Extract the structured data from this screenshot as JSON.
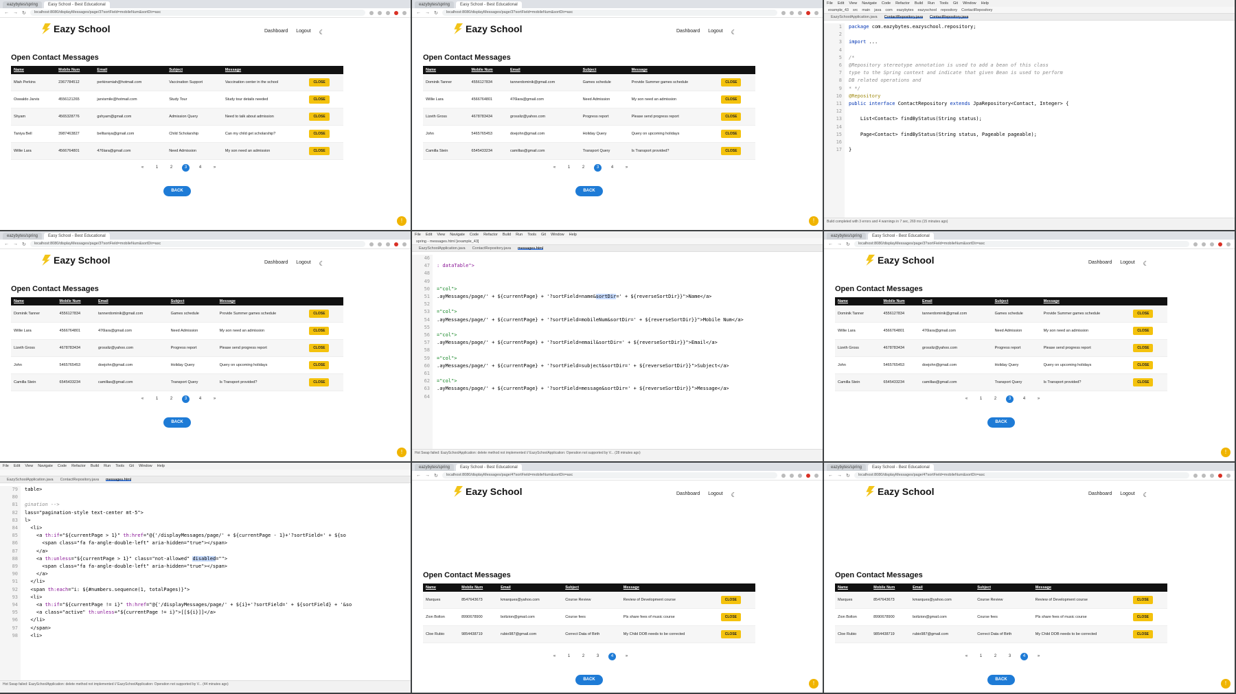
{
  "browser": {
    "tab1": "eazybytes/spring",
    "tab2": "Easy School - Best Educational",
    "url_page3": "localhost:8080/displayMessages/page/3?sortField=mobileNum&sortDir=asc",
    "url_page4": "localhost:8080/displayMessages/page/4?sortField=mobileNum&sortDir=asc"
  },
  "site": {
    "brand": "Eazy School",
    "nav_dashboard": "Dashboard",
    "nav_logout": "Logout",
    "heading": "Open Contact Messages",
    "back": "BACK",
    "close": "CLOSE",
    "columns": [
      "Name",
      "Mobile Num",
      "Email",
      "Subject",
      "Message"
    ],
    "pages": [
      "«",
      "1",
      "2",
      "3",
      "4",
      "»"
    ]
  },
  "sets": {
    "a": [
      [
        "Miah Perkins",
        "2367784512",
        "perkinsmiah@hotmail.com",
        "Vaccination Support",
        "Vaccination center in the school"
      ],
      [
        "Oswaldo Jarvis",
        "4556121265",
        "jarvismile@hotmail.com",
        "Study Tour",
        "Study tour details needed"
      ],
      [
        "Shyam",
        "4565328776",
        "gshyam@gmail.com",
        "Admission Query",
        "Need to talk about admission"
      ],
      [
        "Taniya Bell",
        "3987463827",
        "belltaniya@gmail.com",
        "Child Scholarship",
        "Can my child get scholarship?"
      ],
      [
        "Willie Lara",
        "4566764801",
        "476lara@gmail.com",
        "Need Admission",
        "My son need an admission"
      ]
    ],
    "b": [
      [
        "Dominik Tanner",
        "4556127834",
        "tannerdominik@gmail.com",
        "Games schedule",
        "Provide Summer games schedule"
      ],
      [
        "Willie Lara",
        "4566764801",
        "476lara@gmail.com",
        "Need Admission",
        "My son need an admission"
      ],
      [
        "Lizeth Gross",
        "4678783434",
        "grossliz@yahoo.com",
        "Progress report",
        "Please send progress report"
      ],
      [
        "John",
        "5465765453",
        "doejohn@gmail.com",
        "Holiday Query",
        "Query on upcoming holidays"
      ],
      [
        "Camilla Stein",
        "6545433234",
        "camillas@gmail.com",
        "Transport Query",
        "Is Transport provided?"
      ]
    ],
    "c": [
      [
        "Marques",
        "8547643673",
        "kmarques@yahoo.com",
        "Course Review",
        "Review of Development course"
      ],
      [
        "Zion Bolton",
        "8990678900",
        "boltzion@gmail.com",
        "Course fees",
        "Pls share fees of music course"
      ],
      [
        "Cloe Rubio",
        "9854438719",
        "rubio987@gmail.com",
        "Correct Data of Birth",
        "My Child DOB needs to be corrected"
      ]
    ]
  },
  "ide1": {
    "menu": [
      "File",
      "Edit",
      "View",
      "Navigate",
      "Code",
      "Refactor",
      "Build",
      "Run",
      "Tools",
      "Git",
      "Window",
      "Help"
    ],
    "crumbs": [
      "example_43",
      "src",
      "main",
      "java",
      "com",
      "eazybytes",
      "eazyschool",
      "repository",
      "ContactRepository"
    ],
    "tabs": [
      "EazySchoolApplication.java",
      "ContactRepository.java",
      "ContactRepository.java"
    ],
    "status": "Build completed with 3 errors and 4 warnings in 7 sec, 269 ms (15 minutes ago)"
  },
  "ide2": {
    "title": "spring - messages.html [example_43]",
    "tabs": [
      "EazySchoolApplication.java",
      "ContactRepository.java",
      "messages.html"
    ],
    "status": "Hot Swap failed: EazySchoolApplication: delete method not implemented // EazySchoolApplication: Operation not supported by V... (28 minutes ago)"
  },
  "ide3": {
    "tabs": [
      "EazySchoolApplication.java",
      "ContactRepository.java",
      "messages.html"
    ],
    "status": "Hot Swap failed: EazySchoolApplication: delete method not implemented // EazySchoolApplication: Operation not supported by V... (44 minutes ago)"
  }
}
